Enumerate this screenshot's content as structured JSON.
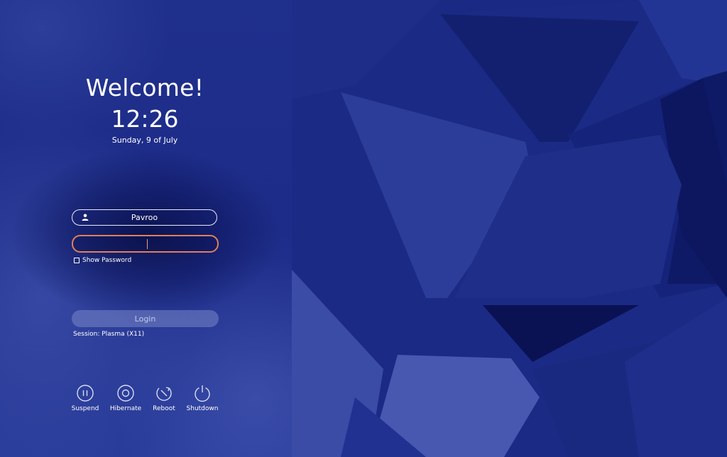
{
  "greeting": "Welcome!",
  "clock": {
    "time": "12:26",
    "date": "Sunday, 9 of July"
  },
  "login_form": {
    "username": "Pavroo",
    "password_value": "",
    "show_password_label": "Show Password",
    "show_password_checked": false,
    "login_label": "Login",
    "session_label": "Session: Plasma (X11)"
  },
  "power_actions": [
    {
      "label": "Suspend",
      "icon": "pause-icon"
    },
    {
      "label": "Hibernate",
      "icon": "disc-icon"
    },
    {
      "label": "Reboot",
      "icon": "reboot-icon"
    },
    {
      "label": "Shutdown",
      "icon": "power-icon"
    }
  ],
  "colors": {
    "background": "#1c2c86",
    "password_focus": "#e0805a",
    "login_button": "#7887c8"
  }
}
